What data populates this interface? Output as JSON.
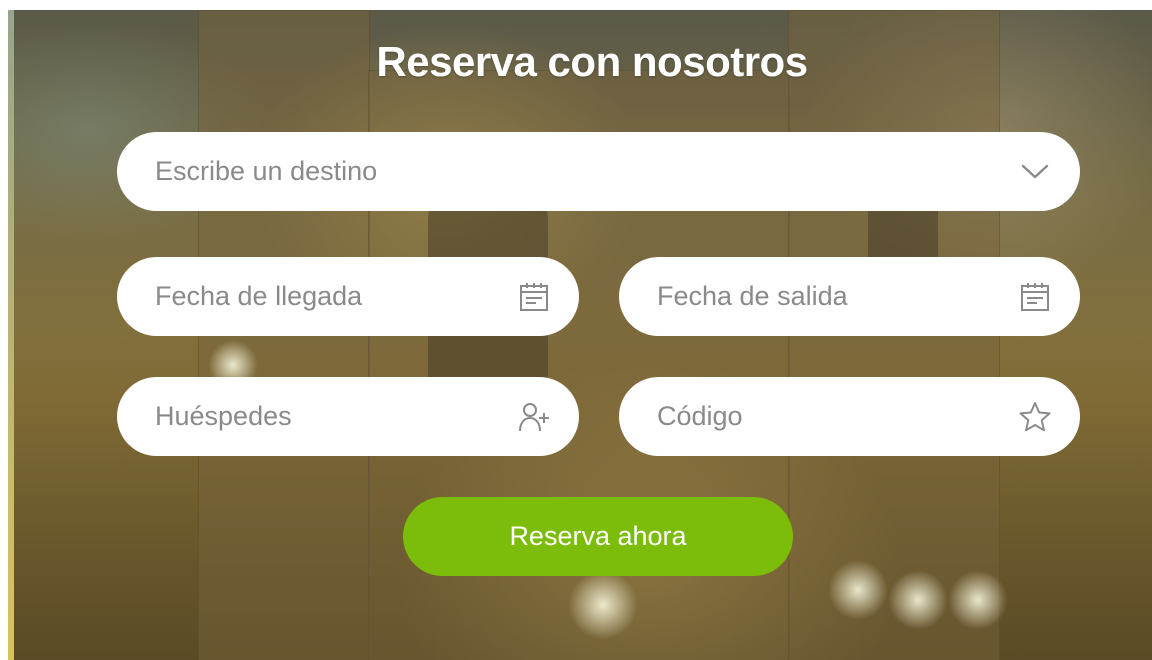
{
  "form": {
    "title": "Reserva con nosotros",
    "destination": {
      "placeholder": "Escribe un destino",
      "icon": "chevron-down-icon"
    },
    "arrival": {
      "placeholder": "Fecha de llegada",
      "icon": "calendar-icon"
    },
    "departure": {
      "placeholder": "Fecha de salida",
      "icon": "calendar-icon"
    },
    "guests": {
      "placeholder": "Huéspedes",
      "icon": "add-user-icon"
    },
    "code": {
      "placeholder": "Código",
      "icon": "star-icon"
    },
    "submit_label": "Reserva ahora"
  },
  "colors": {
    "accent": "#7cbc0a",
    "field_bg": "#ffffff",
    "placeholder": "#8a8a8a",
    "title": "#ffffff",
    "icon": "#8a8a8a"
  }
}
